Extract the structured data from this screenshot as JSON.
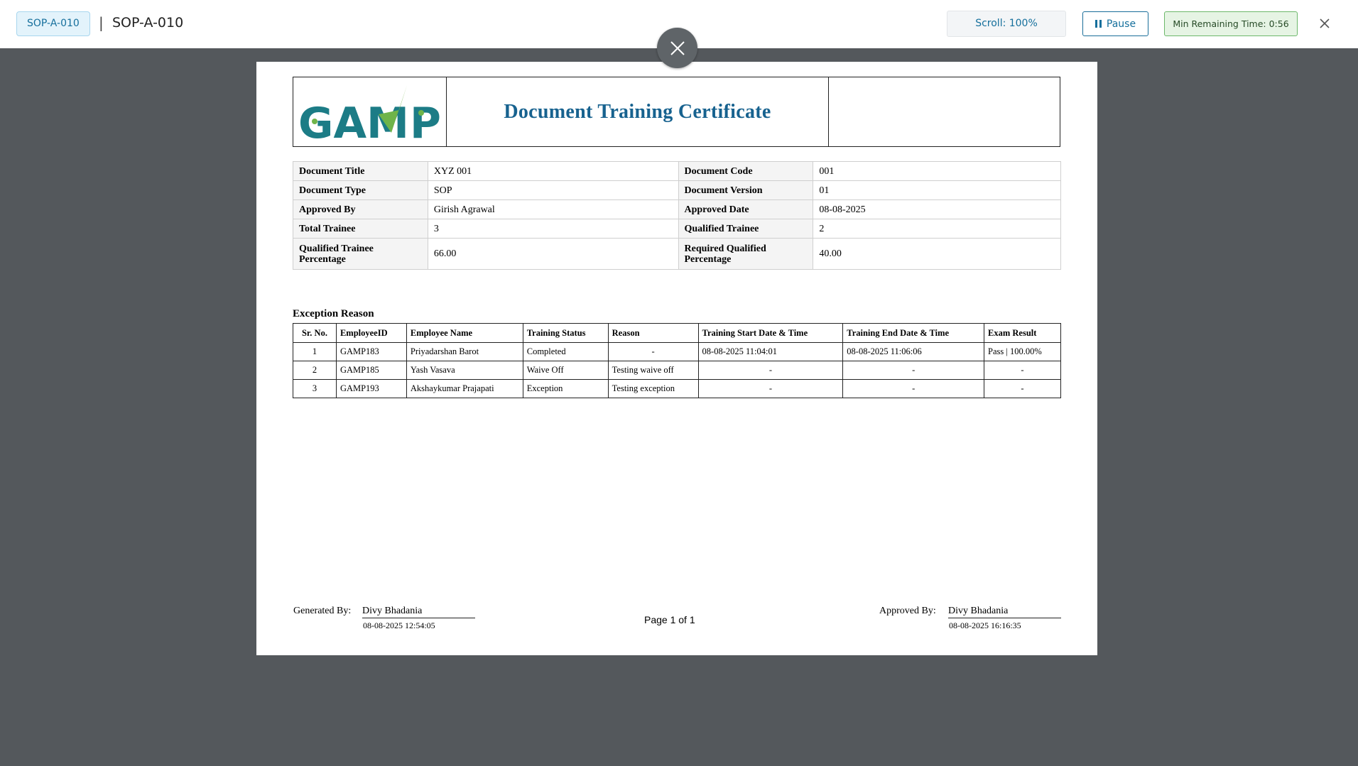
{
  "header": {
    "doc_badge": "SOP-A-010",
    "separator": "|",
    "title": "SOP-A-010",
    "scroll": "Scroll: 100%",
    "pause_label": "Pause",
    "timer": "Min Remaining Time: 0:56"
  },
  "certificate": {
    "logo_text": "GAMP",
    "title": "Document Training Certificate",
    "info_rows": [
      {
        "l1": "Document Title",
        "v1": "XYZ 001",
        "l2": "Document Code",
        "v2": "001"
      },
      {
        "l1": "Document Type",
        "v1": "SOP",
        "l2": "Document Version",
        "v2": "01"
      },
      {
        "l1": "Approved By",
        "v1": "Girish Agrawal",
        "l2": "Approved Date",
        "v2": "08-08-2025"
      },
      {
        "l1": "Total Trainee",
        "v1": "3",
        "l2": "Qualified Trainee",
        "v2": "2"
      },
      {
        "l1": "Qualified Trainee Percentage",
        "v1": "66.00",
        "l2": "Required Qualified Percentage",
        "v2": "40.00"
      }
    ],
    "exception_title": "Exception Reason",
    "exception_columns": [
      "Sr. No.",
      "EmployeeID",
      "Employee Name",
      "Training Status",
      "Reason",
      "Training Start Date & Time",
      "Training End Date & Time",
      "Exam Result"
    ],
    "exception_rows": [
      [
        "1",
        "GAMP183",
        "Priyadarshan Barot",
        "Completed",
        "-",
        "08-08-2025 11:04:01",
        "08-08-2025 11:06:06",
        "Pass | 100.00%"
      ],
      [
        "2",
        "GAMP185",
        "Yash Vasava",
        "Waive Off",
        "Testing waive off",
        "-",
        "-",
        "-"
      ],
      [
        "3",
        "GAMP193",
        "Akshaykumar Prajapati",
        "Exception",
        "Testing exception",
        "-",
        "-",
        "-"
      ]
    ],
    "footer": {
      "generated_label": "Generated By:",
      "generated_name": "Divy Bhadania",
      "generated_date": "08-08-2025 12:54:05",
      "page": "Page 1 of 1",
      "approved_label": "Approved By:",
      "approved_name": "Divy Bhadania",
      "approved_date": "08-08-2025 16:16:35"
    }
  },
  "colors": {
    "accent": "#156f9c",
    "title_blue": "#17628f",
    "logo_teal": "#1c7c86",
    "logo_green": "#6fb44a",
    "backdrop": "#54585c",
    "timer_bg": "#e6f4e4"
  },
  "icons": [
    "pause-icon",
    "close-icon",
    "logo-checkmark-icon"
  ]
}
